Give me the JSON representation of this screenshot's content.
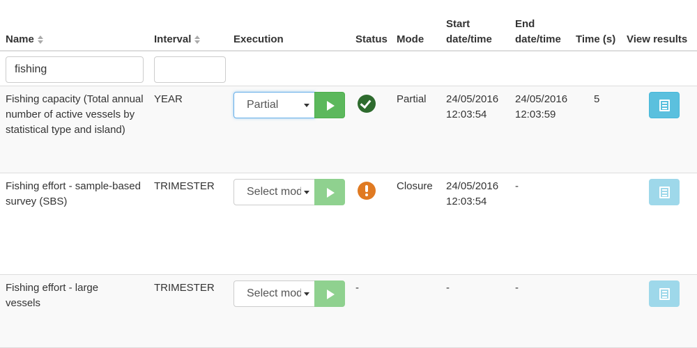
{
  "headers": {
    "name": "Name",
    "interval": "Interval",
    "execution": "Execution",
    "status": "Status",
    "mode": "Mode",
    "start": "Start date/time",
    "end": "End date/time",
    "time": "Time (s)",
    "view": "View results"
  },
  "filters": {
    "name_value": "fishing",
    "interval_value": ""
  },
  "rows": [
    {
      "name": "Fishing capacity (Total annual number of active vessels by statistical type and island)",
      "interval": "YEAR",
      "execution": "Partial",
      "status": "success",
      "mode": "Partial",
      "start": "24/05/2016 12:03:54",
      "end": "24/05/2016 12:03:59",
      "time": "5"
    },
    {
      "name": "Fishing effort - sample-based survey (SBS)",
      "interval": "TRIMESTER",
      "execution": "Select mode",
      "status": "warning",
      "mode": "Closure",
      "start": "24/05/2016 12:03:54",
      "end": "-",
      "time": ""
    },
    {
      "name": "Fishing effort - large vessels",
      "interval": "TRIMESTER",
      "execution": "Select mode",
      "status": "-",
      "mode": "",
      "start": "-",
      "end": "-",
      "time": ""
    }
  ],
  "colors": {
    "success": "#2e6b2e",
    "warning": "#e07a22",
    "run": "#5cb85c",
    "view": "#5bc0de"
  },
  "icons": {
    "sort": "sort-icon",
    "run": "play-icon",
    "view": "document-icon"
  }
}
